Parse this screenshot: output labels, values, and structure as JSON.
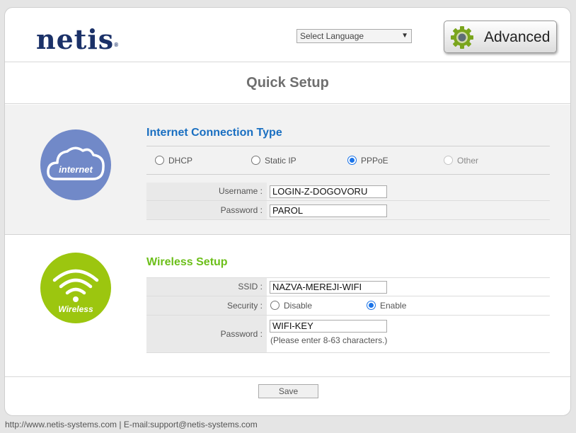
{
  "header": {
    "logo_text": "netis",
    "logo_mark": "®",
    "language_select": "Select Language",
    "advanced_label": "Advanced",
    "advanced_icon": "gear-icon"
  },
  "page_title": "Quick Setup",
  "internet": {
    "title": "Internet Connection Type",
    "icon_label": "internet",
    "icon": "cloud-icon",
    "connection_types": [
      {
        "label": "DHCP",
        "checked": false,
        "disabled": false
      },
      {
        "label": "Static IP",
        "checked": false,
        "disabled": false
      },
      {
        "label": "PPPoE",
        "checked": true,
        "disabled": false
      },
      {
        "label": "Other",
        "checked": false,
        "disabled": true
      }
    ],
    "username_label": "Username :",
    "username_value": "LOGIN-Z-DOGOVORU",
    "password_label": "Password :",
    "password_value": "PAROL"
  },
  "wireless": {
    "title": "Wireless Setup",
    "icon_label": "Wireless",
    "icon": "wifi-icon",
    "ssid_label": "SSID :",
    "ssid_value": "NAZVA-MEREJI-WIFI",
    "security_label": "Security :",
    "security_options": [
      {
        "label": "Disable",
        "checked": false
      },
      {
        "label": "Enable",
        "checked": true
      }
    ],
    "password_label": "Password :",
    "password_value": "WIFI-KEY",
    "password_hint": "(Please enter 8-63 characters.)"
  },
  "save_label": "Save",
  "footer_text": "http://www.netis-systems.com | E-mail:support@netis-systems.com",
  "colors": {
    "internet_circle": "#7189c8",
    "wireless_circle": "#9cc60f",
    "internet_title": "#1a6fc1",
    "wireless_title": "#6cbf1a",
    "logo": "#1b3168",
    "radio_accent": "#1a73e8"
  }
}
